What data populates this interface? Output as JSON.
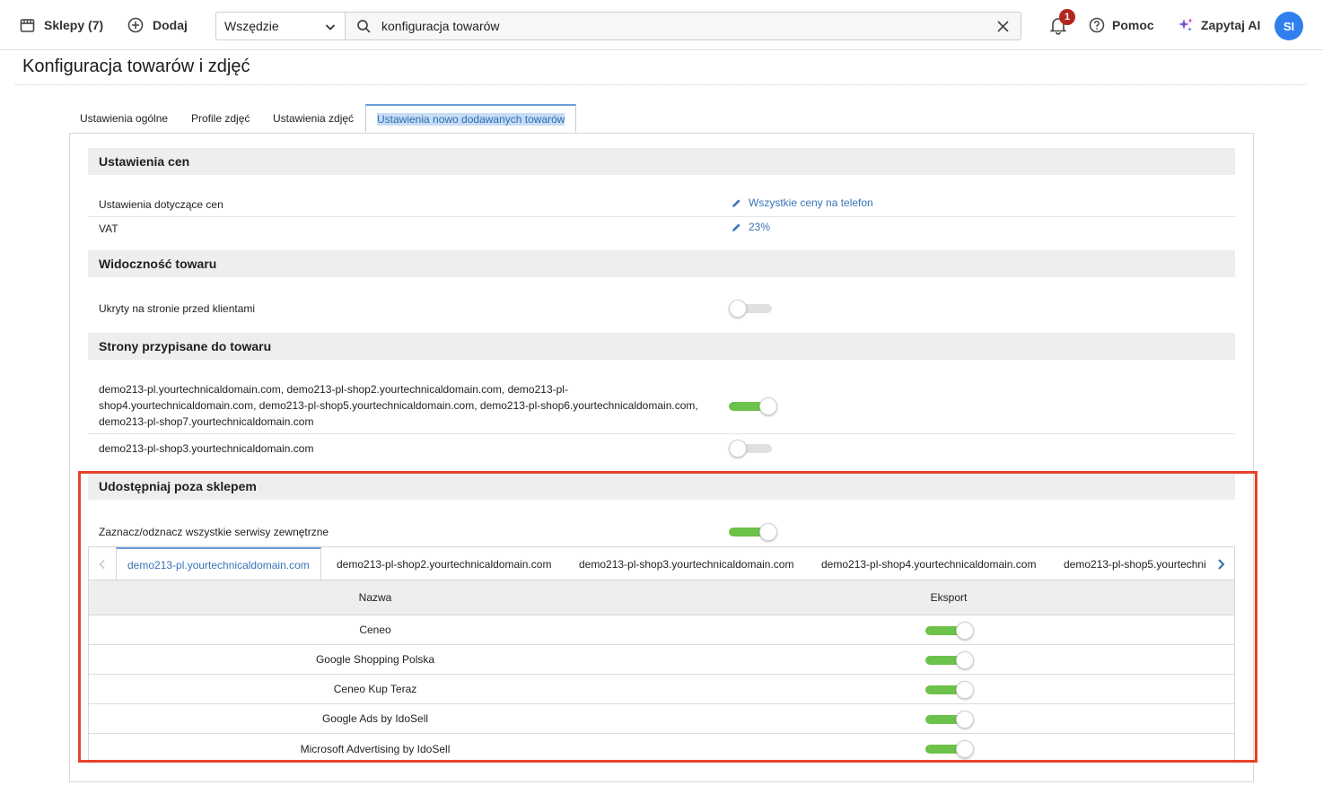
{
  "topbar": {
    "shops_label": "Sklepy (7)",
    "add_label": "Dodaj",
    "scope_select": "Wszędzie",
    "search_value": "konfiguracja towarów",
    "notifications_count": "1",
    "help_label": "Pomoc",
    "ai_label": "Zapytaj AI",
    "avatar_initials": "SI"
  },
  "page": {
    "title": "Konfiguracja towarów i zdjęć"
  },
  "tabs": [
    {
      "label": "Ustawienia ogólne",
      "active": false
    },
    {
      "label": "Profile zdjęć",
      "active": false
    },
    {
      "label": "Ustawienia zdjęć",
      "active": false
    },
    {
      "label": "Ustawienia nowo dodawanych towarów",
      "active": true
    }
  ],
  "sections": {
    "prices": {
      "title": "Ustawienia cen",
      "rows": [
        {
          "label": "Ustawienia dotyczące cen",
          "value": "Wszystkie ceny na telefon"
        },
        {
          "label": "VAT",
          "value": "23%"
        }
      ]
    },
    "visibility": {
      "title": "Widoczność towaru",
      "rows": [
        {
          "label": "Ukryty na stronie przed klientami",
          "on": false
        }
      ]
    },
    "pages": {
      "title": "Strony przypisane do towaru",
      "rows": [
        {
          "label_line1": "demo213-pl.yourtechnicaldomain.com, demo213-pl-shop2.yourtechnicaldomain.com, demo213-pl-",
          "label_line2": "shop4.yourtechnicaldomain.com, demo213-pl-shop5.yourtechnicaldomain.com, demo213-pl-shop6.yourtechnicaldomain.com,",
          "label_line3": "demo213-pl-shop7.yourtechnicaldomain.com",
          "on": true
        },
        {
          "label": "demo213-pl-shop3.yourtechnicaldomain.com",
          "on": false
        }
      ]
    },
    "share": {
      "title": "Udostępniaj poza sklepem",
      "select_all_label": "Zaznacz/odznacz wszystkie serwisy zewnętrzne",
      "select_all_on": true,
      "shop_tabs": [
        "demo213-pl.yourtechnicaldomain.com",
        "demo213-pl-shop2.yourtechnicaldomain.com",
        "demo213-pl-shop3.yourtechnicaldomain.com",
        "demo213-pl-shop4.yourtechnicaldomain.com",
        "demo213-pl-shop5.yourtechni"
      ],
      "table": {
        "headers": [
          "Nazwa",
          "Eksport"
        ],
        "rows": [
          {
            "name": "Ceneo",
            "export": true
          },
          {
            "name": "Google Shopping Polska",
            "export": true
          },
          {
            "name": "Ceneo Kup Teraz",
            "export": true
          },
          {
            "name": "Google Ads by IdoSell",
            "export": true
          },
          {
            "name": "Microsoft Advertising by IdoSell",
            "export": true
          }
        ]
      }
    }
  },
  "colors": {
    "accent": "#3a73b8",
    "toggle_on": "#6cc24a",
    "highlight": "#e5432b",
    "badge": "#b3261e"
  }
}
